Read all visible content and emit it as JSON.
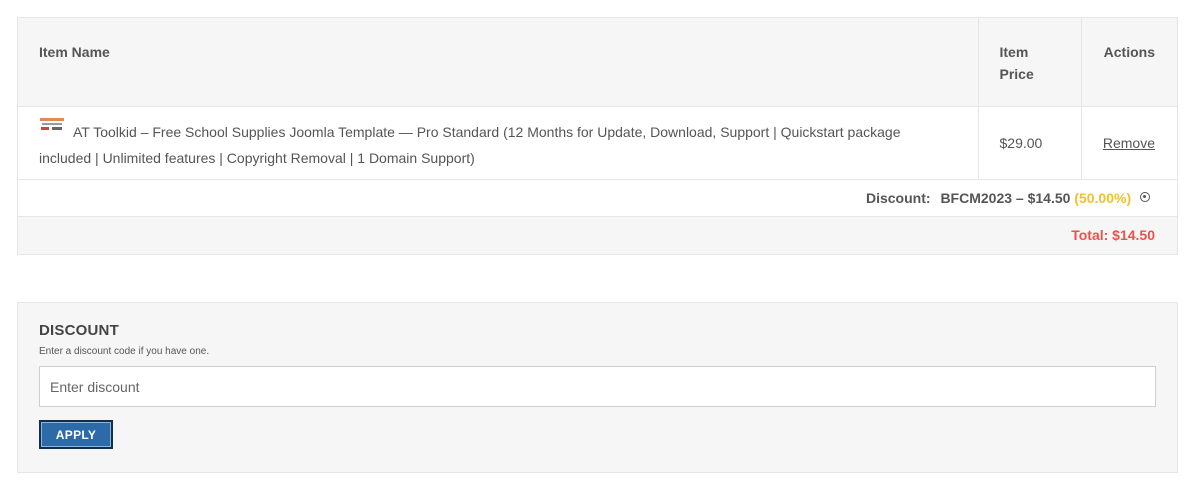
{
  "cart": {
    "columns": {
      "name": "Item Name",
      "price_line1": "Item",
      "price_line2": "Price",
      "actions": "Actions"
    },
    "item": {
      "name": "AT Toolkid – Free School Supplies Joomla Template — Pro Standard (12 Months for Update, Download, Support | Quickstart package included | Unlimited features | Copyright Removal | 1 Domain Support)",
      "price": "$29.00",
      "remove_label": "Remove"
    },
    "discount": {
      "label": "Discount:",
      "code_amount": "BFCM2023 – $14.50",
      "percent": "(50.00%)",
      "percent_color": "#f2c12e"
    },
    "total": {
      "text": "Total: $14.50",
      "color": "#e8534b"
    }
  },
  "discount_form": {
    "title": "DISCOUNT",
    "help": "Enter a discount code if you have one.",
    "placeholder": "Enter discount",
    "apply_label": "APPLY",
    "button_color": "#2c6aa8"
  }
}
